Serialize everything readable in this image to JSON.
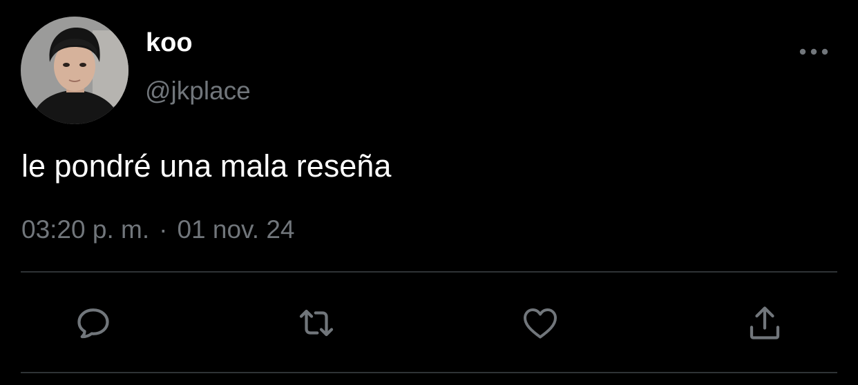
{
  "tweet": {
    "display_name": "koo",
    "handle": "@jkplace",
    "text": "le pondré una mala reseña",
    "time": "03:20 p. m.",
    "separator": "·",
    "date": "01 nov. 24"
  },
  "icons": {
    "more": "more-horizontal-icon",
    "reply": "reply-icon",
    "retweet": "retweet-icon",
    "like": "heart-icon",
    "share": "share-icon"
  },
  "colors": {
    "background": "#000000",
    "primary_text": "#ffffff",
    "secondary_text": "#71767b",
    "icon": "#71767b",
    "divider": "#2f3336"
  }
}
